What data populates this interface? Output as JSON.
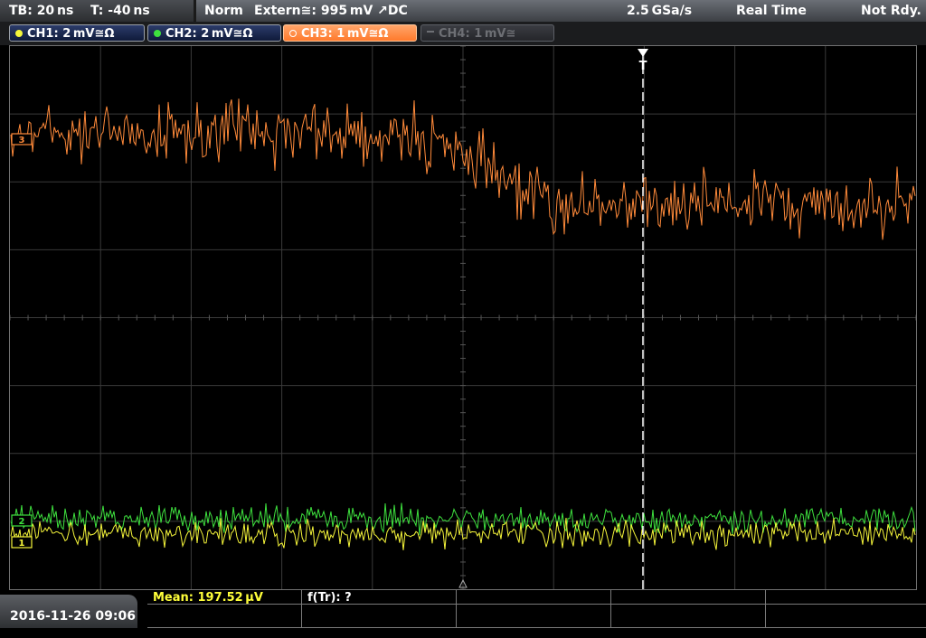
{
  "topbar": {
    "timebase": "TB: 20 ns",
    "trigger_time": "T: -40 ns",
    "mode": "Norm",
    "trigger_source": "Extern≅: 995 mV ↗DC",
    "sample_rate": "2.5 GSa/s",
    "acq_mode": "Real Time",
    "status": "Not Rdy."
  },
  "channels": [
    {
      "label": "CH1: 2 mV≅Ω",
      "color": "#f5f53a",
      "state": "on"
    },
    {
      "label": "CH2: 2 mV≅Ω",
      "color": "#3ee13e",
      "state": "on"
    },
    {
      "label": "CH3: 1 mV≅Ω",
      "color": "#ff8a3a",
      "state": "selected"
    },
    {
      "label": "CH4: 1 mV≅",
      "color": "#6d6f74",
      "state": "off"
    }
  ],
  "markers": {
    "trigger": "T",
    "ch3_ref": "3",
    "ch2_ref": "2",
    "ch1_ref": "1"
  },
  "bottombar": {
    "datetime": "2016-11-26 09:06",
    "mean": "Mean: 197.52 µV",
    "ftr": "f(Tr): ?"
  },
  "colors": {
    "ch1": "#f5f53a",
    "ch2": "#3ee13e",
    "ch3": "#ff8a3a",
    "grid": "#3a3a3a",
    "trigger": "#ffffff"
  }
}
